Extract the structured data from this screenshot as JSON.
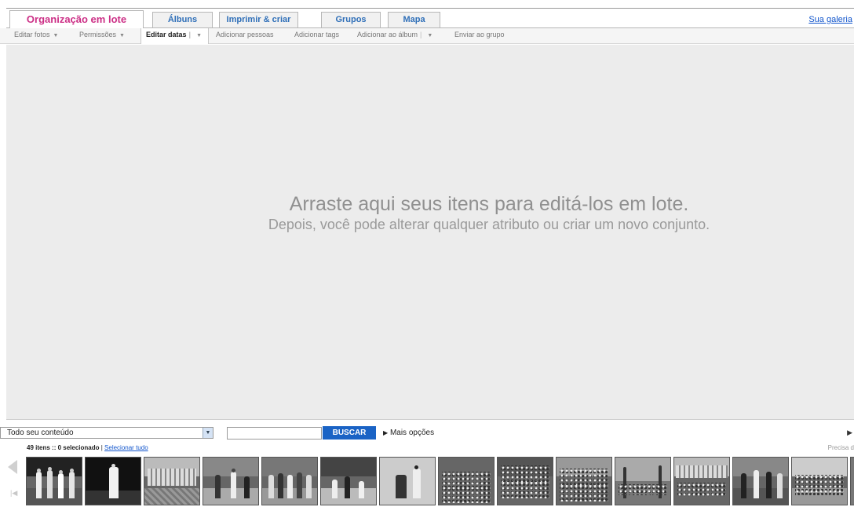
{
  "tabs": [
    {
      "label": "Organização em lote",
      "active": true
    },
    {
      "label": "Álbuns",
      "active": false
    },
    {
      "label": "Imprimir & criar",
      "active": false
    },
    {
      "label": "Grupos",
      "active": false
    },
    {
      "label": "Mapa",
      "active": false
    }
  ],
  "header": {
    "galeria_link": "Sua galeria"
  },
  "toolbar": {
    "editar_fotos": "Editar fotos",
    "permissoes": "Permissões",
    "editar_datas": "Editar datas",
    "adicionar_pessoas": "Adicionar pessoas",
    "adicionar_tags": "Adicionar tags",
    "adicionar_album": "Adicionar ao álbum",
    "enviar_grupo": "Enviar ao grupo",
    "dropdown_icon": "chevron-down-icon"
  },
  "dropzone": {
    "title": "Arraste aqui seus itens para editá-los em lote.",
    "subtitle": "Depois, você pode alterar qualquer atributo ou criar um novo conjunto."
  },
  "filter": {
    "content_select": "Todo seu conteúdo",
    "search_value": "",
    "search_button": "BUSCAR",
    "more_options": "Mais opções",
    "items_count": "49 itens",
    "selected_count": ":: 0 selecionado",
    "separator": "|",
    "select_all": "Selecionar tudo",
    "help_text": "Precisa d"
  },
  "colors": {
    "active_tab": "#cc2f86",
    "tab_text": "#2f6fb8",
    "buscar_bg": "#1a63c5",
    "dropzone_bg": "#ececec"
  },
  "thumbnails": [
    {
      "icon": "photo-thumbnail",
      "scene": "people-portrait"
    },
    {
      "icon": "photo-thumbnail",
      "scene": "dancer-dark"
    },
    {
      "icon": "photo-thumbnail",
      "scene": "building-street"
    },
    {
      "icon": "photo-thumbnail",
      "scene": "courtyard-people"
    },
    {
      "icon": "photo-thumbnail",
      "scene": "group-outdoor"
    },
    {
      "icon": "photo-thumbnail",
      "scene": "children-playing"
    },
    {
      "icon": "photo-thumbnail",
      "scene": "lab-microscope"
    },
    {
      "icon": "photo-thumbnail",
      "scene": "class-group"
    },
    {
      "icon": "photo-thumbnail",
      "scene": "crowd-event"
    },
    {
      "icon": "photo-thumbnail",
      "scene": "crowd-stage"
    },
    {
      "icon": "photo-thumbnail",
      "scene": "palm-yard"
    },
    {
      "icon": "photo-thumbnail",
      "scene": "school-assembly"
    },
    {
      "icon": "photo-thumbnail",
      "scene": "ceremony"
    },
    {
      "icon": "photo-thumbnail",
      "scene": "street-parade"
    },
    {
      "icon": "photo-thumbnail",
      "scene": "partial"
    }
  ]
}
